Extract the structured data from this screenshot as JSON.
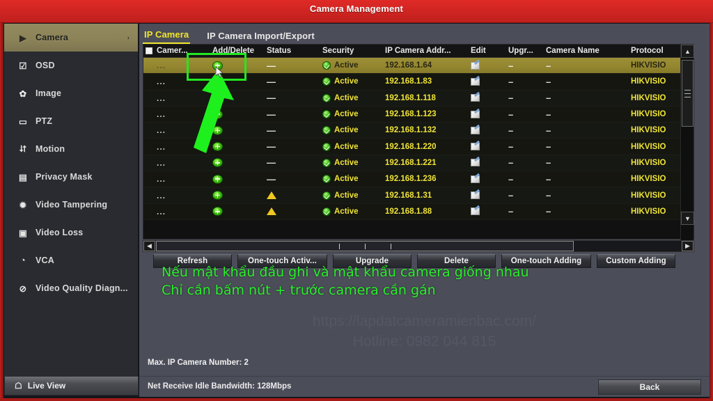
{
  "window": {
    "title": "Camera Management"
  },
  "sidebar": {
    "items": [
      {
        "label": "Camera",
        "icon": "camera-icon",
        "active": true,
        "chevron": "›"
      },
      {
        "label": "OSD",
        "icon": "osd-icon",
        "active": false
      },
      {
        "label": "Image",
        "icon": "image-icon",
        "active": false
      },
      {
        "label": "PTZ",
        "icon": "ptz-icon",
        "active": false
      },
      {
        "label": "Motion",
        "icon": "motion-icon",
        "active": false
      },
      {
        "label": "Privacy Mask",
        "icon": "privacy-mask-icon",
        "active": false
      },
      {
        "label": "Video Tampering",
        "icon": "video-tampering-icon",
        "active": false
      },
      {
        "label": "Video Loss",
        "icon": "video-loss-icon",
        "active": false
      },
      {
        "label": "VCA",
        "icon": "vca-icon",
        "active": false
      },
      {
        "label": "Video Quality Diagn...",
        "icon": "video-quality-icon",
        "active": false
      }
    ],
    "live_view_label": "Live View",
    "live_view_icon": "home-icon"
  },
  "tabs": [
    {
      "label": "IP Camera",
      "active": true
    },
    {
      "label": "IP Camera Import/Export",
      "active": false
    }
  ],
  "table": {
    "headers": {
      "checkbox": "",
      "camera": "Camer...",
      "add_delete": "Add/Delete",
      "status": "Status",
      "security": "Security",
      "ip_address": "IP Camera Addr...",
      "edit": "Edit",
      "upgrade": "Upgr...",
      "camera_name": "Camera Name",
      "protocol": "Protocol"
    },
    "rows": [
      {
        "camera": "...",
        "add": "add-icon",
        "status": "dash",
        "security": "Active",
        "ip": "192.168.1.64",
        "edit": "edit-icon",
        "upgrade": "–",
        "name": "–",
        "protocol": "HIKVISIO",
        "selected": true
      },
      {
        "camera": "...",
        "add": "add-icon",
        "status": "dash",
        "security": "Active",
        "ip": "192.168.1.83",
        "edit": "edit-icon",
        "upgrade": "–",
        "name": "–",
        "protocol": "HIKVISIO",
        "selected": false
      },
      {
        "camera": "...",
        "add": "add-icon",
        "status": "dash",
        "security": "Active",
        "ip": "192.168.1.118",
        "edit": "edit-icon",
        "upgrade": "–",
        "name": "–",
        "protocol": "HIKVISIO",
        "selected": false
      },
      {
        "camera": "...",
        "add": "add-icon",
        "status": "dash",
        "security": "Active",
        "ip": "192.168.1.123",
        "edit": "edit-icon",
        "upgrade": "–",
        "name": "–",
        "protocol": "HIKVISIO",
        "selected": false
      },
      {
        "camera": "...",
        "add": "add-icon",
        "status": "dash",
        "security": "Active",
        "ip": "192.168.1.132",
        "edit": "edit-icon",
        "upgrade": "–",
        "name": "–",
        "protocol": "HIKVISIO",
        "selected": false
      },
      {
        "camera": "...",
        "add": "add-icon",
        "status": "dash",
        "security": "Active",
        "ip": "192.168.1.220",
        "edit": "edit-icon",
        "upgrade": "–",
        "name": "–",
        "protocol": "HIKVISIO",
        "selected": false
      },
      {
        "camera": "...",
        "add": "add-icon",
        "status": "dash",
        "security": "Active",
        "ip": "192.168.1.221",
        "edit": "edit-icon",
        "upgrade": "–",
        "name": "–",
        "protocol": "HIKVISIO",
        "selected": false
      },
      {
        "camera": "...",
        "add": "add-icon",
        "status": "dash",
        "security": "Active",
        "ip": "192.168.1.236",
        "edit": "edit-icon",
        "upgrade": "–",
        "name": "–",
        "protocol": "HIKVISIO",
        "selected": false
      },
      {
        "camera": "...",
        "add": "add-icon",
        "status": "warning",
        "security": "Active",
        "ip": "192.168.1.31",
        "edit": "edit-icon",
        "upgrade": "–",
        "name": "–",
        "protocol": "HIKVISIO",
        "selected": false
      },
      {
        "camera": "...",
        "add": "add-icon",
        "status": "warning",
        "security": "Active",
        "ip": "192.168.1.88",
        "edit": "edit-icon",
        "upgrade": "–",
        "name": "–",
        "protocol": "HIKVISIO",
        "selected": false
      }
    ]
  },
  "buttons": [
    {
      "label": "Refresh",
      "width": 113
    },
    {
      "label": "One-touch Activ...",
      "width": 129
    },
    {
      "label": "Upgrade",
      "width": 113
    },
    {
      "label": "Delete",
      "width": 113
    },
    {
      "label": "One-touch Adding",
      "width": 129
    },
    {
      "label": "Custom Adding",
      "width": 113
    }
  ],
  "annotation": {
    "note": "Nếu mật khẩu đầu ghi và mật khẩu camera giống nhau\nChỉ cần bấm nút + trước camera cần gán",
    "color": "#2bf02b"
  },
  "watermark": {
    "line1": "https://lapdatcameramienbac.com/",
    "line2": "Hotline: 0982 044 815"
  },
  "footer": {
    "max_ip_camera": "Max. IP Camera Number: 2",
    "bandwidth": "Net Receive Idle Bandwidth: 128Mbps",
    "back_label": "Back"
  },
  "scroll": {
    "up_icon": "chevron-up-icon",
    "down_icon": "chevron-down-icon",
    "left_icon": "chevron-left-icon",
    "right_icon": "chevron-right-icon"
  }
}
